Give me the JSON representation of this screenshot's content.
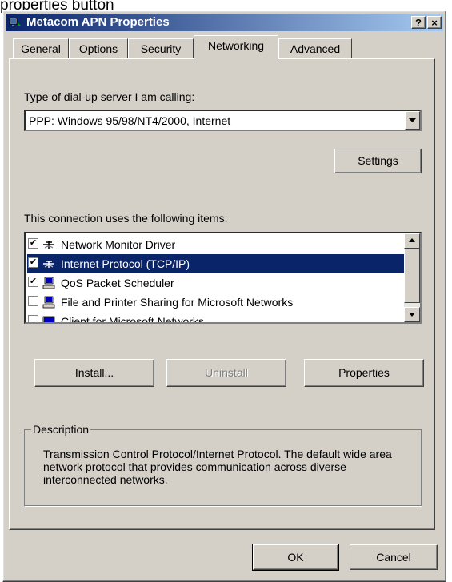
{
  "caption": "properties button",
  "window": {
    "title": "Metacom APN Properties",
    "help_btn": "?",
    "close_btn": "×"
  },
  "tabs": [
    {
      "label": "General"
    },
    {
      "label": "Options"
    },
    {
      "label": "Security"
    },
    {
      "label": "Networking",
      "active": true
    },
    {
      "label": "Advanced"
    }
  ],
  "server_type": {
    "label": "Type of dial-up server I am calling:",
    "value": "PPP: Windows 95/98/NT4/2000, Internet",
    "settings_button": "Settings"
  },
  "items": {
    "label": "This connection uses the following items:",
    "list": [
      {
        "label": "Network Monitor Driver",
        "checked": true,
        "icon": "network-protocol-icon"
      },
      {
        "label": "Internet Protocol (TCP/IP)",
        "checked": true,
        "icon": "network-protocol-icon",
        "selected": true
      },
      {
        "label": "QoS Packet Scheduler",
        "checked": true,
        "icon": "network-service-icon"
      },
      {
        "label": "File and Printer Sharing for Microsoft Networks",
        "checked": false,
        "icon": "network-service-icon"
      },
      {
        "label": "Client for Microsoft Networks",
        "checked": false,
        "icon": "network-client-icon"
      }
    ],
    "install_button": "Install...",
    "uninstall_button": "Uninstall",
    "properties_button": "Properties"
  },
  "description": {
    "title": "Description",
    "text": "Transmission Control Protocol/Internet Protocol. The default wide area network protocol that provides communication across diverse interconnected networks."
  },
  "footer": {
    "ok_button": "OK",
    "cancel_button": "Cancel"
  },
  "colors": {
    "title_start": "#0a246a",
    "title_end": "#a6caf0",
    "face": "#d4d0c8",
    "selection": "#0a246a"
  }
}
